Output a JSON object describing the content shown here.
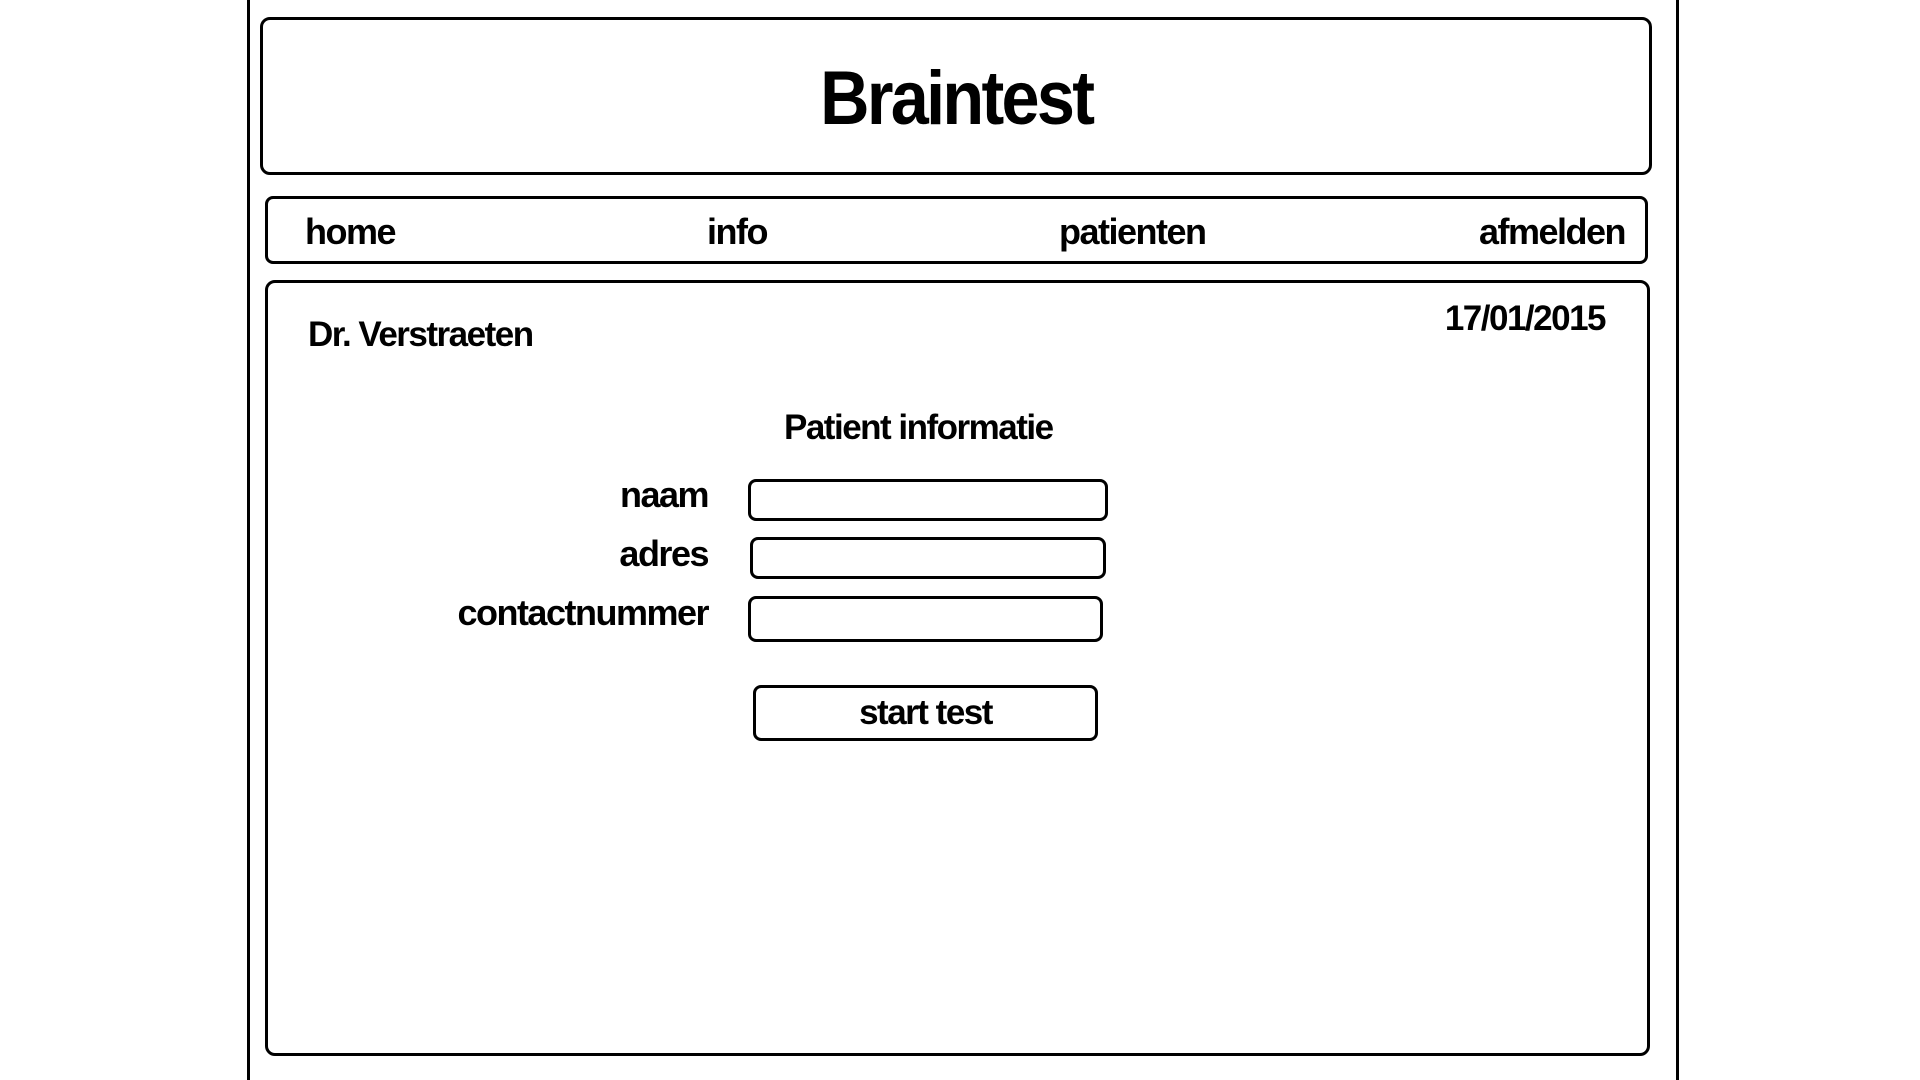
{
  "app": {
    "title": "Braintest"
  },
  "nav": {
    "items": [
      {
        "label": "home"
      },
      {
        "label": "info"
      },
      {
        "label": "patienten"
      },
      {
        "label": "afmelden"
      }
    ]
  },
  "main": {
    "doctor_name": "Dr. Verstraeten",
    "date": "17/01/2015",
    "form": {
      "title": "Patient informatie",
      "fields": [
        {
          "label": "naam",
          "value": ""
        },
        {
          "label": "adres",
          "value": ""
        },
        {
          "label": "contactnummer",
          "value": ""
        }
      ],
      "submit_label": "start test"
    }
  }
}
